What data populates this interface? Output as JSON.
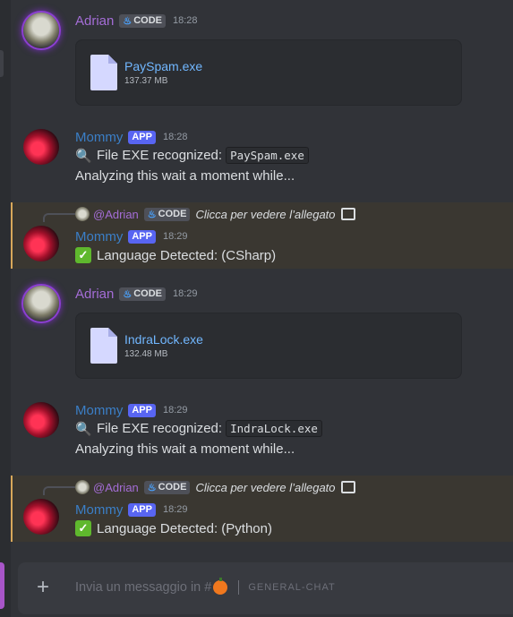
{
  "messages": [
    {
      "author": "Adrian",
      "tag": "CODE",
      "time": "18:28",
      "attachment": {
        "name": "PaySpam.exe",
        "size": "137.37 MB"
      }
    },
    {
      "author": "Mommy",
      "tag": "APP",
      "time": "18:28",
      "line1_prefix": "File EXE recognized:",
      "line1_code": "PaySpam.exe",
      "line2": "Analyzing this wait a moment while..."
    },
    {
      "reply": {
        "author": "@Adrian",
        "tag": "CODE",
        "text": "Clicca per vedere l’allegato"
      },
      "author": "Mommy",
      "tag": "APP",
      "time": "18:29",
      "text": "Language Detected: (CSharp)"
    },
    {
      "author": "Adrian",
      "tag": "CODE",
      "time": "18:29",
      "attachment": {
        "name": "IndraLock.exe",
        "size": "132.48 MB"
      }
    },
    {
      "author": "Mommy",
      "tag": "APP",
      "time": "18:29",
      "line1_prefix": "File EXE recognized:",
      "line1_code": "IndraLock.exe",
      "line2": "Analyzing this wait a moment while..."
    },
    {
      "reply": {
        "author": "@Adrian",
        "tag": "CODE",
        "text": "Clicca per vedere l’allegato"
      },
      "author": "Mommy",
      "tag": "APP",
      "time": "18:29",
      "text": "Language Detected: (Python)"
    }
  ],
  "composer": {
    "placeholder": "Invia un messaggio in #",
    "channel": "GENERAL-CHAT"
  },
  "icons": {
    "search": "magnifier-emoji",
    "check": "check-mark-emoji",
    "file": "file-icon",
    "image": "image-icon",
    "add": "plus-icon",
    "channel_emoji": "pumpkin"
  },
  "colors": {
    "background": "#313338",
    "adrian_name": "#a46dd6",
    "mommy_name": "#3b7fc7",
    "app_badge": "#5865f2",
    "link": "#71b7ff",
    "reply_highlight": "#d8a75a"
  }
}
